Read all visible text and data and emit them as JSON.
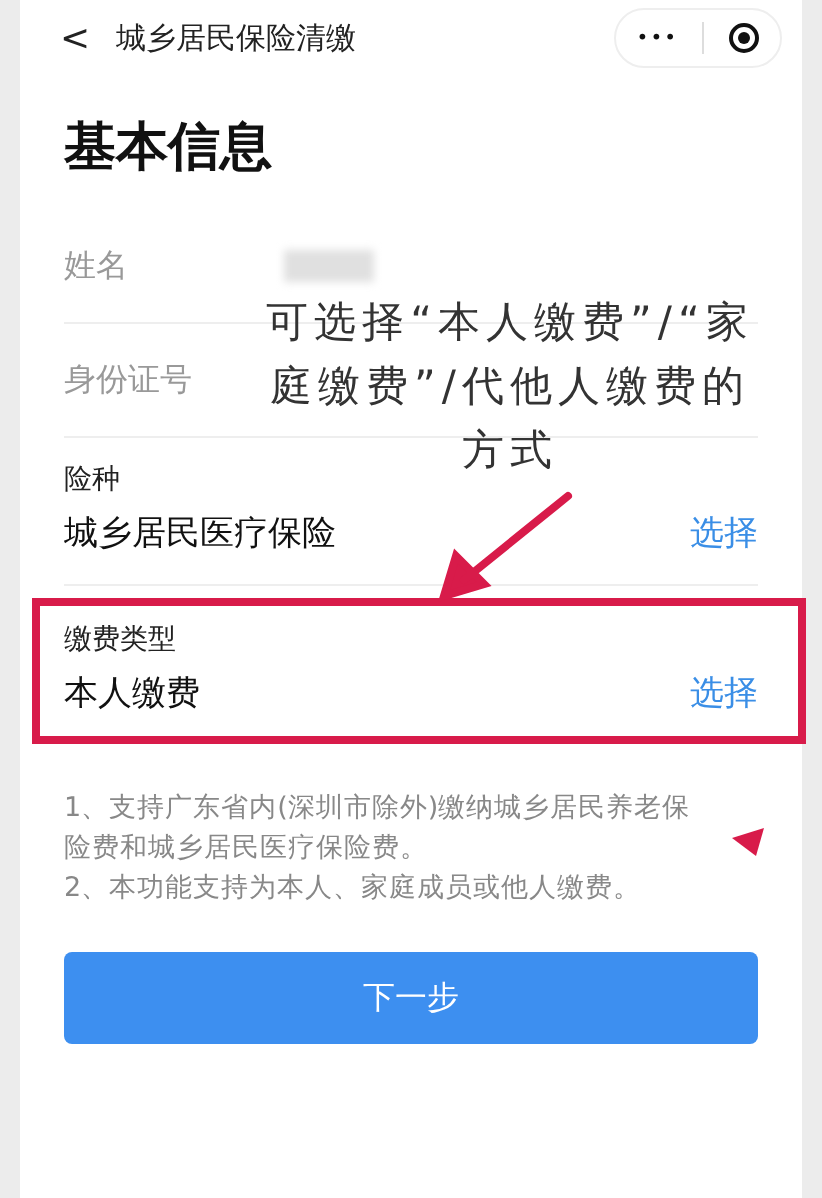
{
  "header": {
    "back": "<",
    "title": "城乡居民保险清缴",
    "more": "•••"
  },
  "heading": "基本信息",
  "info_rows": [
    {
      "label": "姓名"
    },
    {
      "label": "身份证号"
    }
  ],
  "select_rows": [
    {
      "label": "险种",
      "value": "城乡居民医疗保险",
      "action": "选择",
      "highlighted": false
    },
    {
      "label": "缴费类型",
      "value": "本人缴费",
      "action": "选择",
      "highlighted": true
    }
  ],
  "notes": [
    "1、支持广东省内(深圳市除外)缴纳城乡居民养老保险费和城乡居民医疗保险费。",
    "2、本功能支持为本人、家庭成员或他人缴费。"
  ],
  "next_button": "下一步",
  "annotation": "可选择“本人缴费”/“家庭缴费”/代他人缴费的方式"
}
